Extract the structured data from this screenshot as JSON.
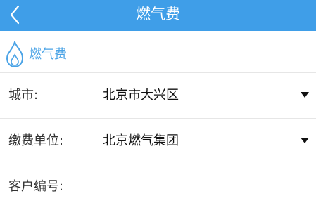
{
  "header": {
    "title": "燃气费",
    "back_icon": "chevron-left-icon",
    "background_color": "#3f9ee8"
  },
  "section": {
    "icon": "flame-icon",
    "title": "燃气费",
    "accent_color": "#4aa3e6"
  },
  "form": {
    "city": {
      "label": "城市:",
      "value": "北京市大兴区"
    },
    "payee": {
      "label": "缴费单位:",
      "value": "北京燃气集团"
    },
    "account": {
      "label": "客户编号:",
      "value": "",
      "placeholder": ""
    }
  }
}
